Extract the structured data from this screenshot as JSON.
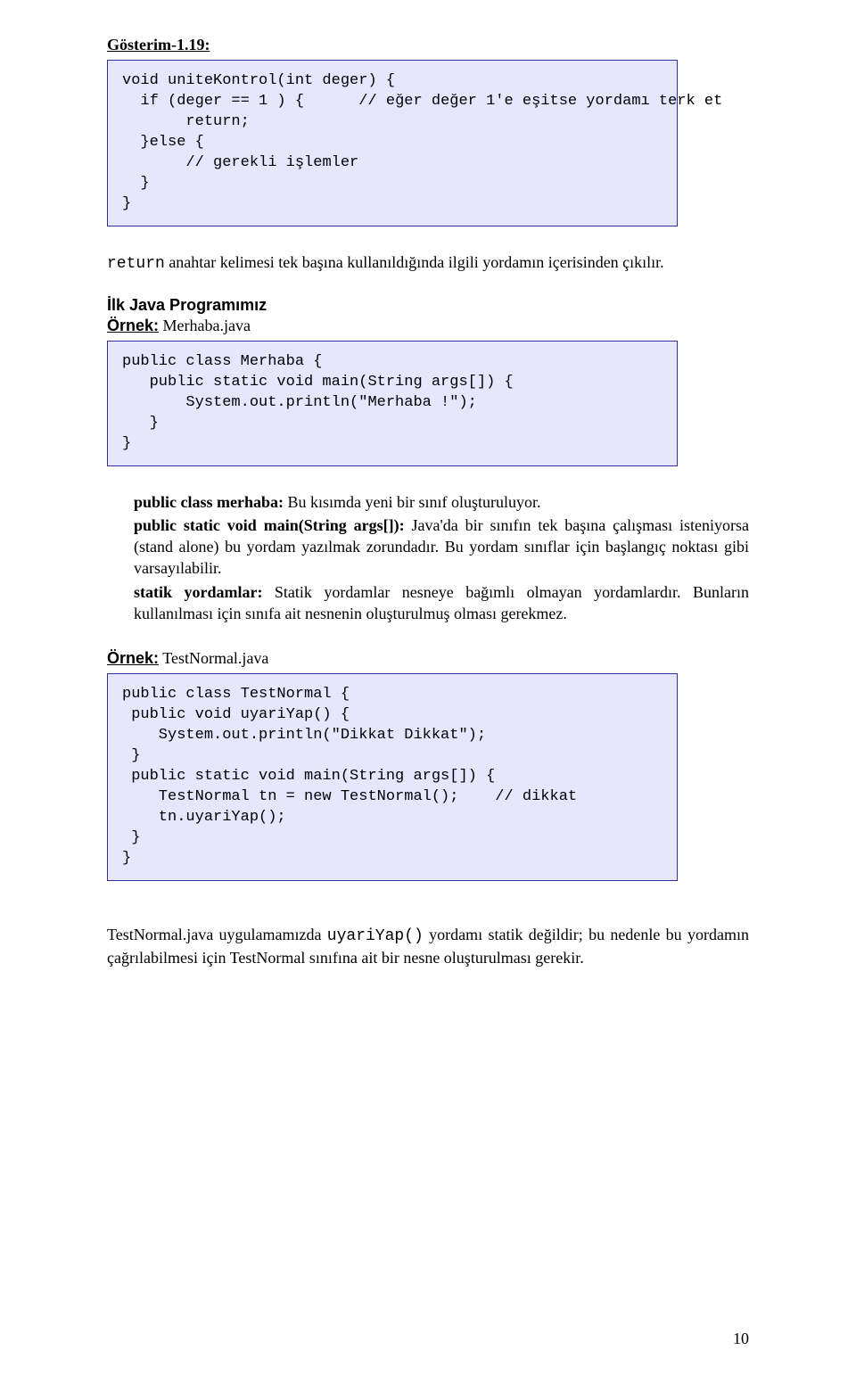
{
  "heading1": "Gösterim-1.19:",
  "code1": {
    "l1": "void uniteKontrol(int deger) {",
    "l2": "  if (deger == 1 ) {",
    "l2c": "// eğer değer 1'e eşitse yordamı terk et",
    "l3": "       return;",
    "l4": "  }else {",
    "l5": "       ",
    "l5c": "// gerekli işlemler",
    "l6": "  }",
    "l7": "}"
  },
  "para1a": "return",
  "para1b": " anahtar kelimesi tek başına kullanıldığında ilgili yordamın içerisinden çıkılır.",
  "section_title": "İlk Java Programımız",
  "example_merhaba_label": "Örnek:",
  "example_merhaba_file": "Merhaba.java",
  "code2": "public class Merhaba {\n   public static void main(String args[]) {\n       System.out.println(\"Merhaba !\");\n   }\n}",
  "body": {
    "p1a": "public class merhaba:",
    "p1b": " Bu kısımda yeni bir sınıf oluşturuluyor.",
    "p2a": "public static void main(String args[]):",
    "p2b": " Java'da bir sınıfın tek başına çalışması isteniyorsa (stand alone) bu yordam yazılmak zorundadır. Bu yordam sınıflar için başlangıç noktası gibi varsayılabilir.",
    "p3a": "statik yordamlar:",
    "p3b": " Statik yordamlar nesneye bağımlı olmayan yordamlardır. Bunların kullanılması için sınıfa ait nesnenin oluşturulmuş olması gerekmez."
  },
  "example_testnormal_label": "Örnek:",
  "example_testnormal_file": "TestNormal.java",
  "code3": {
    "l1": "public class TestNormal {",
    "l2": " public void uyariYap() {",
    "l3": "    System.out.println(\"Dikkat Dikkat\");",
    "l4": " }",
    "l5": " public static void main(String args[]) {",
    "l6": "    TestNormal tn = new TestNormal();",
    "l6c": "// dikkat",
    "l7": "    tn.uyariYap();",
    "l8": " }",
    "l9": "}"
  },
  "para2a": "TestNormal.java uygulamamızda ",
  "para2b": "uyariYap()",
  "para2c": " yordamı statik değildir; bu nedenle  bu yordamın çağrılabilmesi için TestNormal sınıfına ait bir nesne oluşturulması gerekir.",
  "page_number": "10"
}
